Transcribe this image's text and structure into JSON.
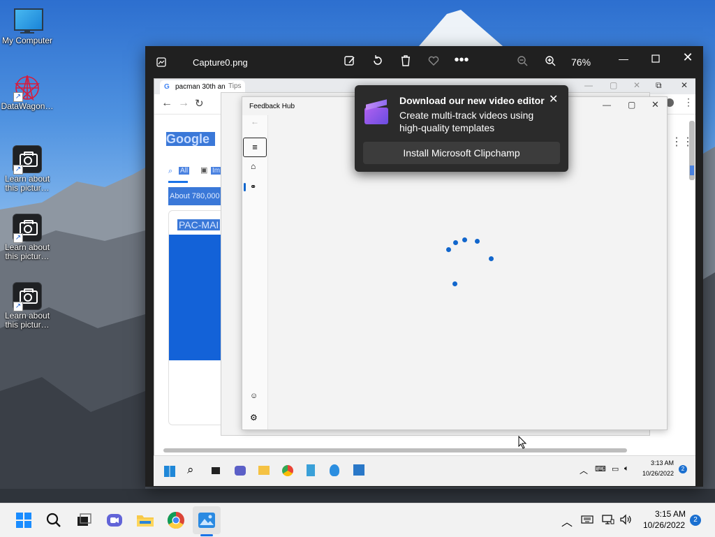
{
  "desktop": {
    "icons": [
      {
        "label": "My Computer"
      },
      {
        "label": "DataWagon…"
      },
      {
        "label": "Learn about this pictur…"
      },
      {
        "label": "Learn about this pictur…"
      },
      {
        "label": "Learn about this pictur…"
      }
    ]
  },
  "photos": {
    "filename": "Capture0.png",
    "zoom": "76%"
  },
  "screenshot": {
    "browser_tab": "pacman 30th an",
    "tips_title": "Tips",
    "google_logo": "Google",
    "search_tab_all": "All",
    "search_tab_images": "Im",
    "results_count": "About 780,000",
    "result_card": "PAC-MAI",
    "feedback_title": "Feedback Hub",
    "inner_clock_time": "3:13 AM",
    "inner_clock_date": "10/26/2022",
    "inner_notifications": "2"
  },
  "toast": {
    "title": "Download our new video editor",
    "body": "Create multi-track videos using high-quality templates",
    "button": "Install Microsoft Clipchamp"
  },
  "taskbar": {
    "time": "3:15 AM",
    "date": "10/26/2022",
    "notifications": "2"
  }
}
